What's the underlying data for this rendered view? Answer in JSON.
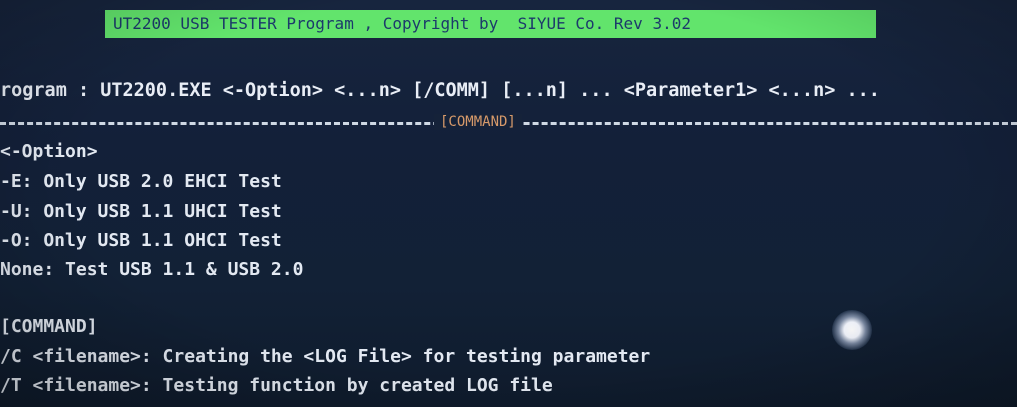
{
  "title_bar": "UT2200 USB TESTER Program , Copyright by  SIYUE Co. Rev 3.02",
  "program_line": "rogram : UT2200.EXE <-Option> <...n> [/COMM] [...n] ... <Parameter1> <...n> ...",
  "divider_label": "[COMMAND]",
  "options": {
    "heading": "<-Option>",
    "items": [
      "-E: Only USB 2.0 EHCI Test",
      "-U: Only USB 1.1 UHCI Test",
      "-O: Only USB 1.1 OHCI Test",
      "None: Test USB 1.1 & USB 2.0"
    ]
  },
  "commands": {
    "heading": "[COMMAND]",
    "items": [
      "/C <filename>: Creating the <LOG File> for testing parameter",
      "/T <filename>: Testing function by created LOG file"
    ]
  },
  "colors": {
    "background": "#132039",
    "title_bar": "#62e46c",
    "text": "#e3e9f2",
    "label": "#d79a6a"
  }
}
